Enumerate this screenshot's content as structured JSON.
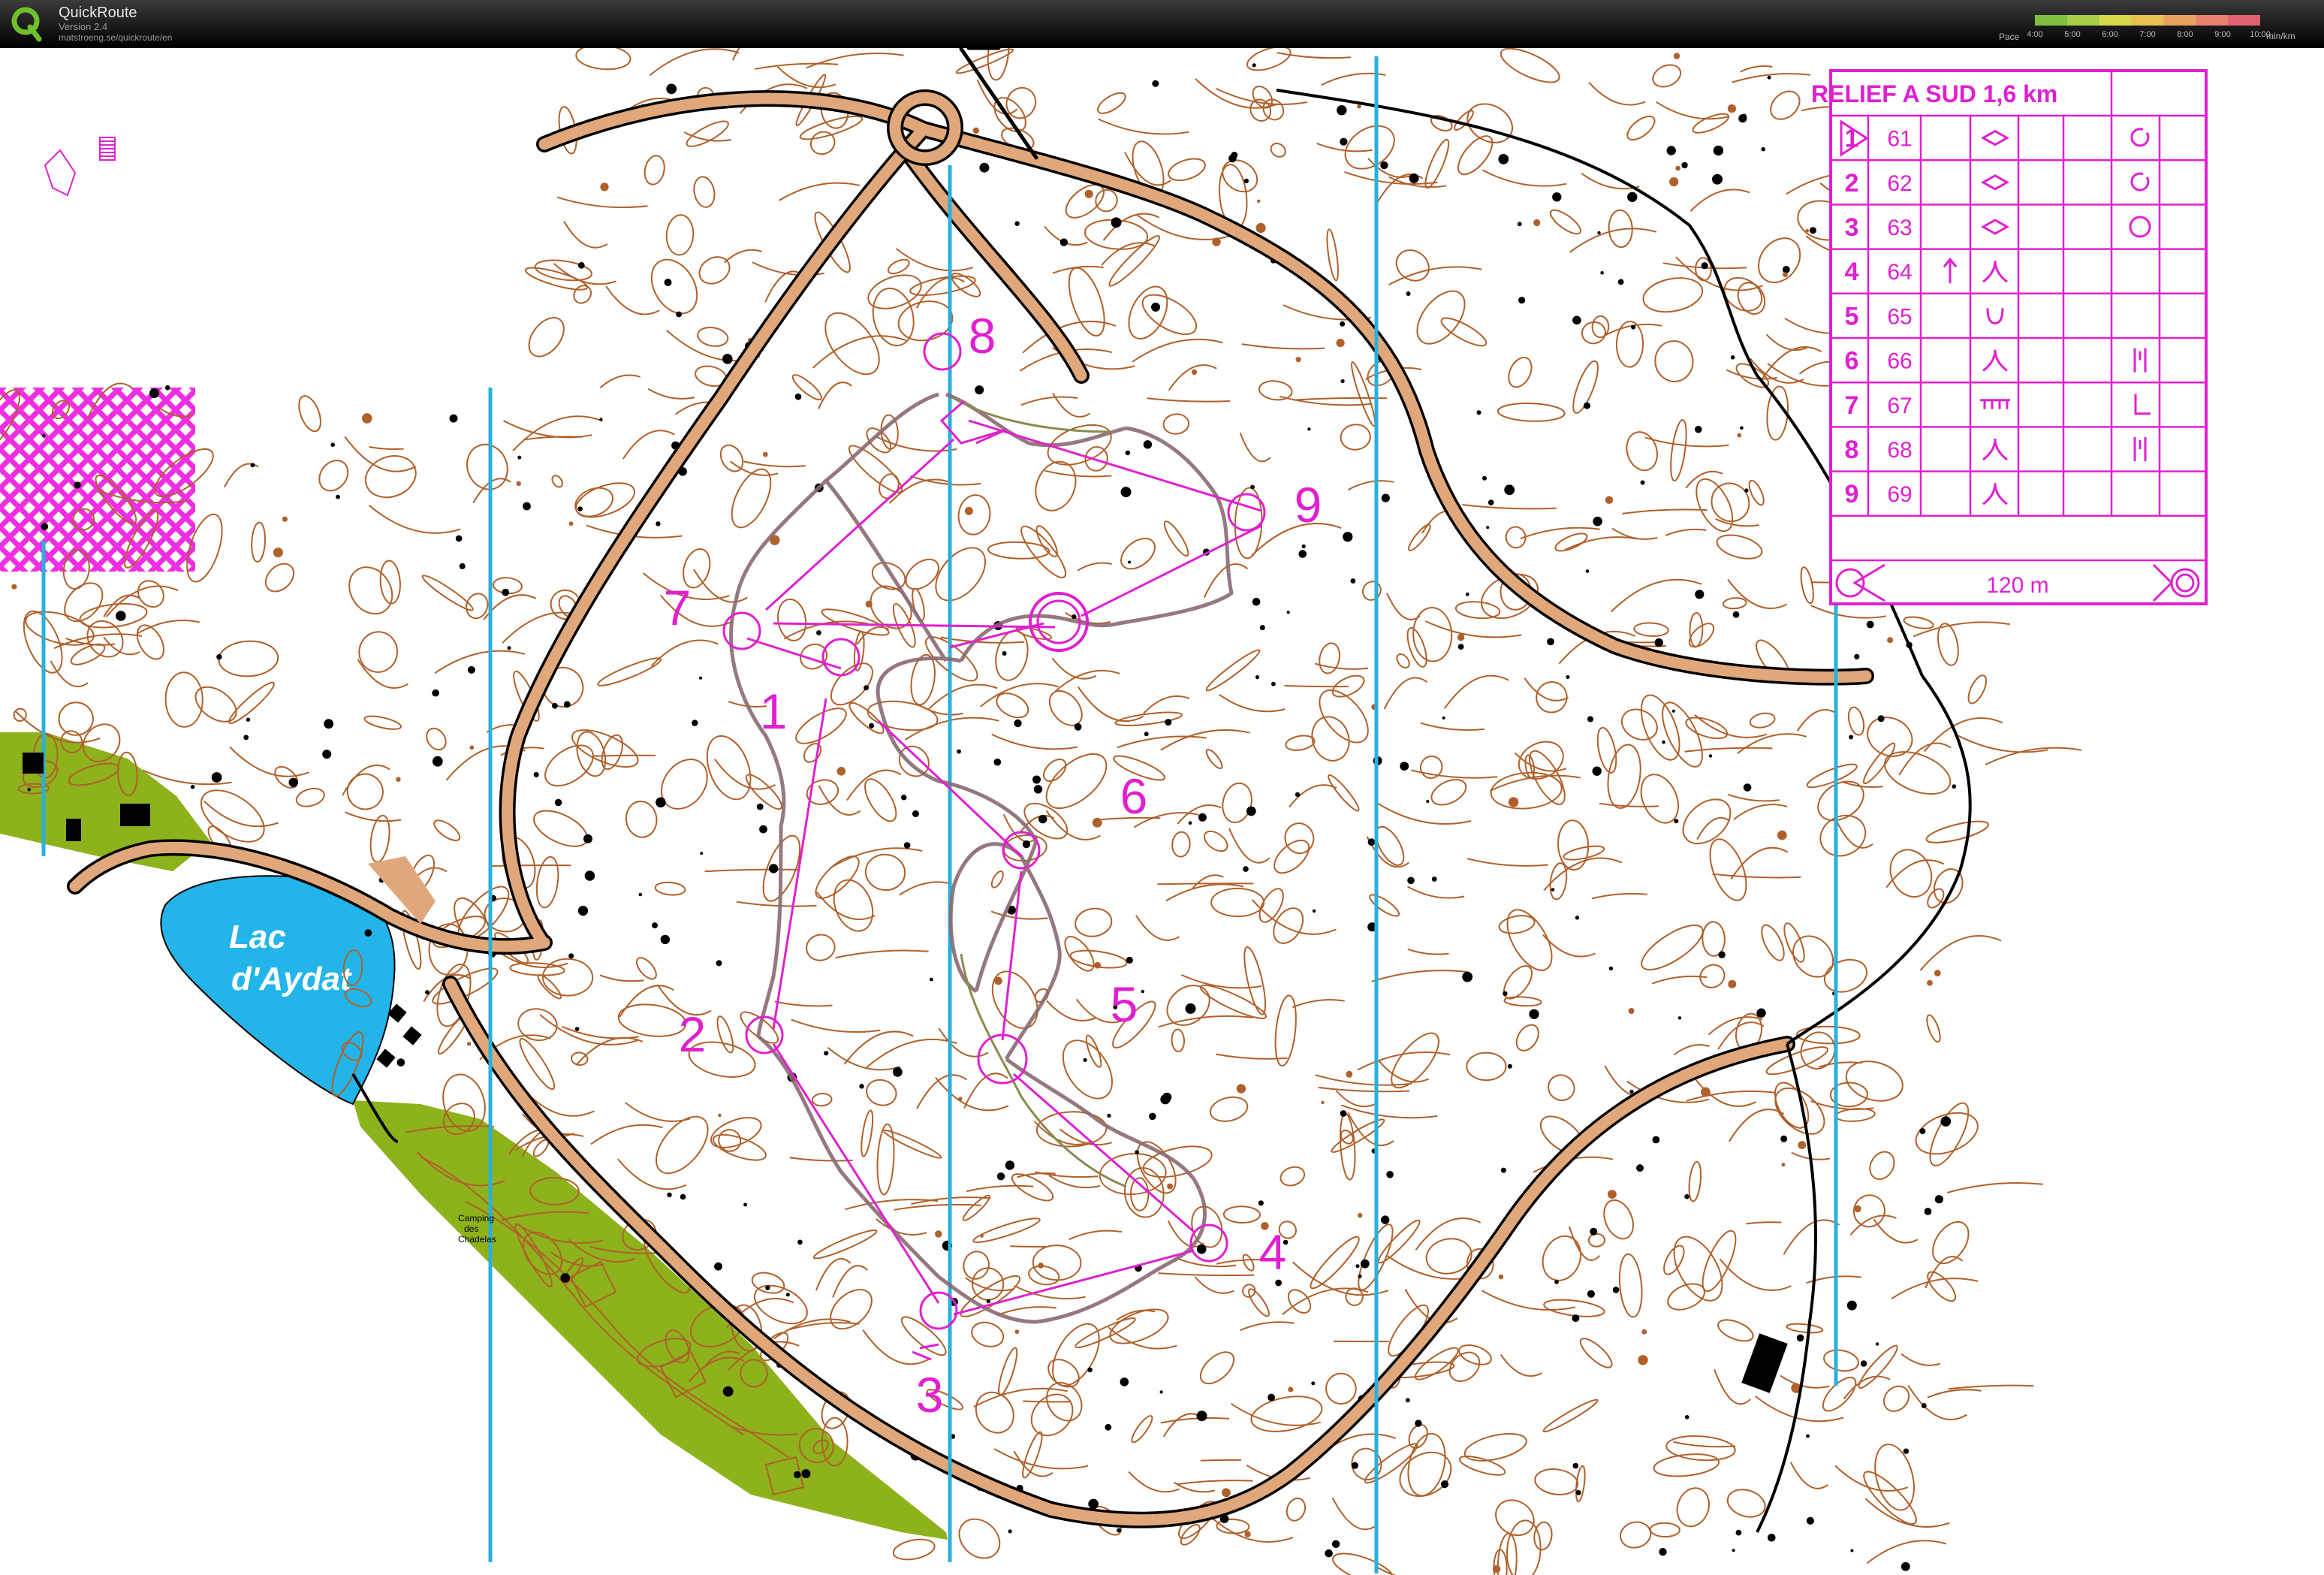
{
  "app": {
    "title": "QuickRoute",
    "version": "Version 2.4",
    "url": "matstroeng.se/quickroute/en",
    "logo_icon": "quickroute-q-logo"
  },
  "pace_legend": {
    "label": "Pace",
    "ticks": [
      "4:00",
      "5:00",
      "6:00",
      "7:00",
      "8:00",
      "9:00",
      "10:00"
    ],
    "unit": "min/km",
    "colors": [
      "#7fbf3f",
      "#a8cc45",
      "#d8d84a",
      "#e8c050",
      "#e8a060",
      "#e88070",
      "#e06070"
    ]
  },
  "map": {
    "lake_label_line1": "Lac",
    "lake_label_line2": "d'Aydat",
    "camping_label_line1": "Camping",
    "camping_label_line2": "des",
    "camping_label_line3": "Chadelas",
    "control_numbers": [
      "1",
      "2",
      "3",
      "4",
      "5",
      "6",
      "7",
      "8",
      "9"
    ],
    "colors": {
      "contour": "#b0602a",
      "road_fill": "#e0a87a",
      "course": "#e020d0",
      "lake": "#23b5ea",
      "green": "#8db21c",
      "north_line": "#2ab0dc",
      "route": "#8a6a70"
    }
  },
  "control_card": {
    "title": "RELIEF A SUD  1,6 km",
    "start_symbol": "start-triangle-icon",
    "rows": [
      {
        "num": "1",
        "code": "61",
        "col_c": "",
        "col_d": "knoll-symbol",
        "col_g": "circle-partial-symbol"
      },
      {
        "num": "2",
        "code": "62",
        "col_c": "",
        "col_d": "knoll-symbol",
        "col_g": "circle-partial-symbol"
      },
      {
        "num": "3",
        "code": "63",
        "col_c": "",
        "col_d": "knoll-symbol",
        "col_g": "circle-open-symbol"
      },
      {
        "num": "4",
        "code": "64",
        "col_c": "north-arrow-symbol",
        "col_d": "spur-symbol",
        "col_g": ""
      },
      {
        "num": "5",
        "code": "65",
        "col_c": "",
        "col_d": "depression-symbol",
        "col_g": ""
      },
      {
        "num": "6",
        "code": "66",
        "col_c": "",
        "col_d": "spur-symbol",
        "col_g": "foot-top-symbol"
      },
      {
        "num": "7",
        "code": "67",
        "col_c": "",
        "col_d": "wall-symbol",
        "col_g": "corner-symbol"
      },
      {
        "num": "8",
        "code": "68",
        "col_c": "",
        "col_d": "spur-symbol",
        "col_g": "foot-top-symbol"
      },
      {
        "num": "9",
        "code": "69",
        "col_c": "",
        "col_d": "spur-symbol",
        "col_g": ""
      }
    ],
    "finish_text": "120 m"
  }
}
